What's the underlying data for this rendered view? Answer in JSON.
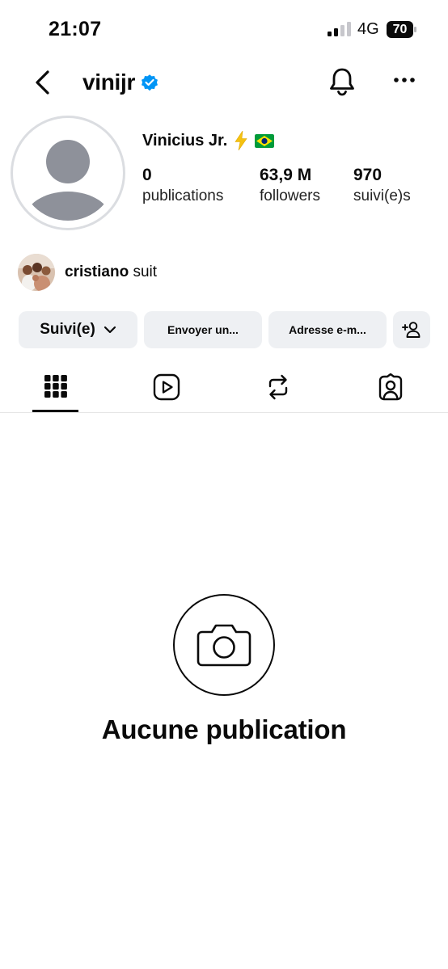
{
  "status_bar": {
    "time": "21:07",
    "network": "4G",
    "battery": "70"
  },
  "header": {
    "username": "vinijr",
    "icons": [
      "back-icon",
      "verified-badge-icon",
      "bell-icon",
      "more-icon"
    ]
  },
  "profile": {
    "display_name": "Vinicius Jr.",
    "emoji_icons": [
      "lightning-bolt-icon",
      "brazil-flag-icon"
    ],
    "stats": [
      {
        "value": "0",
        "label": "publications"
      },
      {
        "value": "63,9 M",
        "label": "followers"
      },
      {
        "value": "970",
        "label": "suivi(e)s"
      }
    ],
    "mutual": {
      "user": "cristiano",
      "suffix": "suit"
    }
  },
  "actions": {
    "follow_label": "Suivi(e)",
    "message_label": "Envoyer un...",
    "email_label": "Adresse e-m...",
    "add_icon": "add-person-icon"
  },
  "tabs": [
    {
      "name": "grid",
      "icon": "grid-icon",
      "active": true
    },
    {
      "name": "reels",
      "icon": "reels-icon",
      "active": false
    },
    {
      "name": "reposts",
      "icon": "repost-icon",
      "active": false
    },
    {
      "name": "tagged",
      "icon": "tagged-icon",
      "active": false
    }
  ],
  "empty_state": {
    "icon": "camera-icon",
    "title": "Aucune publication"
  },
  "colors": {
    "text": "#0a0a0a",
    "button_bg": "#eef0f3",
    "verified": "#0095f6",
    "avatar_placeholder": "#8e919a"
  }
}
